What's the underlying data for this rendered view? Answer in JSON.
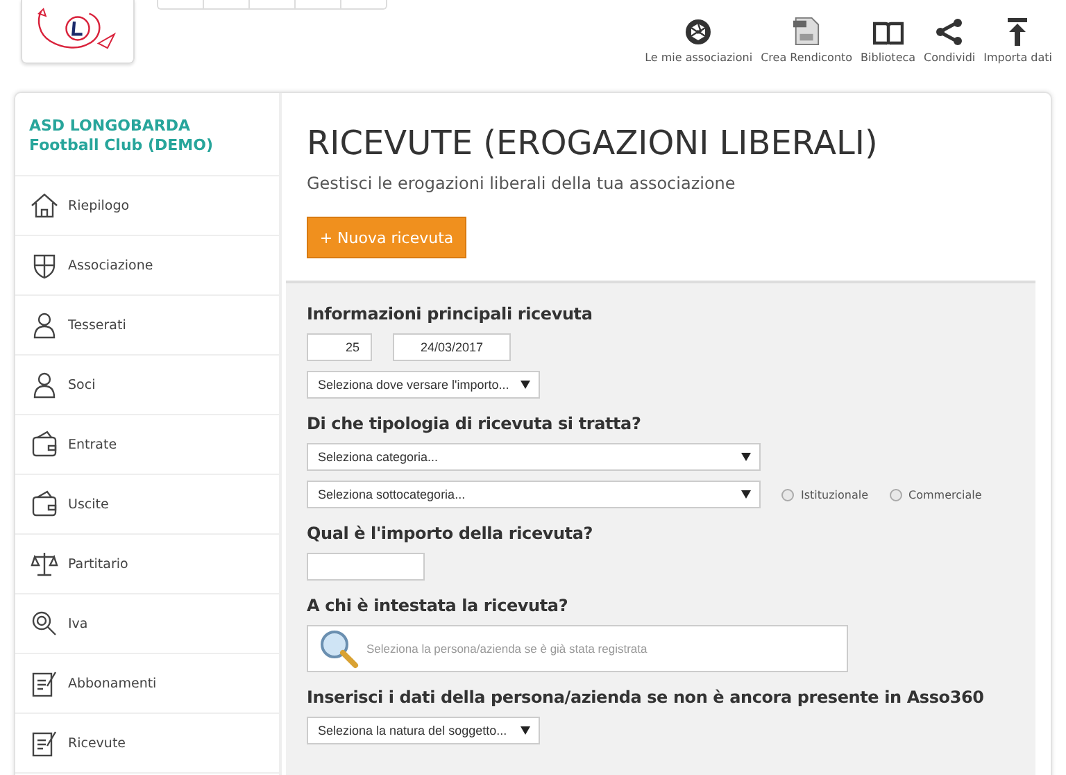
{
  "toolbar": [
    {
      "label": "Le mie associazioni"
    },
    {
      "label": "Crea Rendiconto"
    },
    {
      "label": "Biblioteca"
    },
    {
      "label": "Condividi"
    },
    {
      "label": "Importa dati"
    }
  ],
  "sidebar": {
    "title": "ASD LONGOBARDA Football Club (DEMO)",
    "items": [
      {
        "label": "Riepilogo"
      },
      {
        "label": "Associazione"
      },
      {
        "label": "Tesserati"
      },
      {
        "label": "Soci"
      },
      {
        "label": "Entrate"
      },
      {
        "label": "Uscite"
      },
      {
        "label": "Partitario"
      },
      {
        "label": "Iva"
      },
      {
        "label": "Abbonamenti"
      },
      {
        "label": "Ricevute"
      }
    ]
  },
  "page": {
    "title": "RICEVUTE (EROGAZIONI LIBERALI)",
    "subtitle": "Gestisci le erogazioni liberali della tua associazione",
    "new_button": "+ Nuova ricevuta"
  },
  "form": {
    "sections": [
      {
        "heading": "Informazioni principali ricevuta",
        "rows": [
          [
            {
              "kind": "input",
              "value": "25"
            },
            {
              "kind": "input",
              "value": "24/03/2017"
            }
          ],
          [
            {
              "kind": "select",
              "value": "Seleziona dove versare l'importo..."
            }
          ]
        ]
      },
      {
        "heading": "Di che tipologia di ricevuta si tratta?",
        "rows": [
          [
            {
              "kind": "select",
              "value": "Seleziona categoria..."
            }
          ],
          [
            {
              "kind": "select",
              "value": "Seleziona sottocategoria..."
            },
            {
              "kind": "radio",
              "label": "Istituzionale",
              "selected": false
            },
            {
              "kind": "radio",
              "label": "Commerciale",
              "selected": false
            }
          ]
        ]
      },
      {
        "heading": "Qual è l'importo della ricevuta?",
        "rows": [
          [
            {
              "kind": "input"
            }
          ]
        ]
      },
      {
        "heading": "A chi è intestata la ricevuta?",
        "rows": [
          [
            {
              "kind": "search",
              "placeholder": "Seleziona la persona/azienda se è già stata registrata"
            }
          ]
        ]
      },
      {
        "heading": "Inserisci i dati della persona/azienda se non è ancora presente in Asso360",
        "rows": [
          [
            {
              "kind": "select",
              "value": "Seleziona la natura del soggetto..."
            }
          ]
        ]
      }
    ]
  }
}
